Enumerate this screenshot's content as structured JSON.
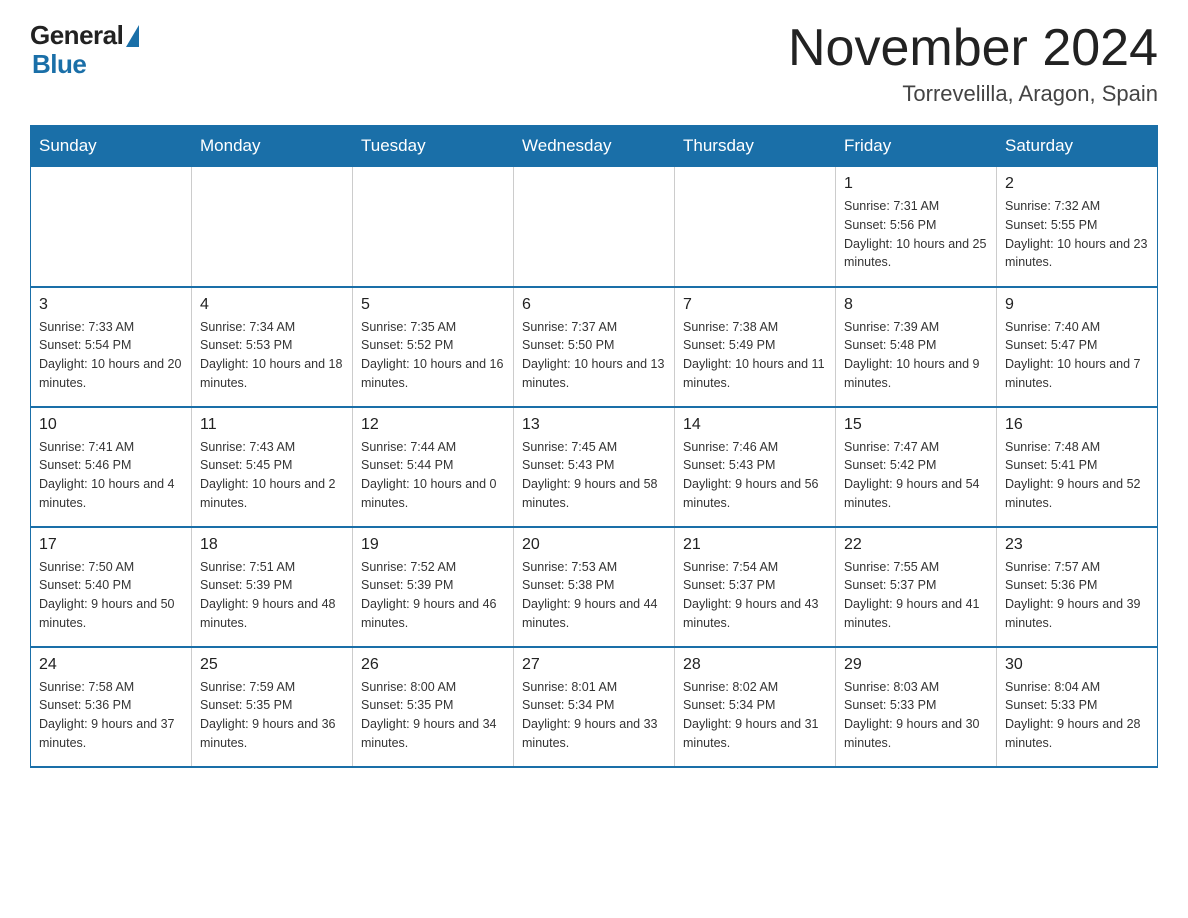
{
  "header": {
    "logo_general": "General",
    "logo_blue": "Blue",
    "month_title": "November 2024",
    "location": "Torrevelilla, Aragon, Spain"
  },
  "days_of_week": [
    "Sunday",
    "Monday",
    "Tuesday",
    "Wednesday",
    "Thursday",
    "Friday",
    "Saturday"
  ],
  "weeks": [
    [
      {
        "day": "",
        "info": ""
      },
      {
        "day": "",
        "info": ""
      },
      {
        "day": "",
        "info": ""
      },
      {
        "day": "",
        "info": ""
      },
      {
        "day": "",
        "info": ""
      },
      {
        "day": "1",
        "info": "Sunrise: 7:31 AM\nSunset: 5:56 PM\nDaylight: 10 hours and 25 minutes."
      },
      {
        "day": "2",
        "info": "Sunrise: 7:32 AM\nSunset: 5:55 PM\nDaylight: 10 hours and 23 minutes."
      }
    ],
    [
      {
        "day": "3",
        "info": "Sunrise: 7:33 AM\nSunset: 5:54 PM\nDaylight: 10 hours and 20 minutes."
      },
      {
        "day": "4",
        "info": "Sunrise: 7:34 AM\nSunset: 5:53 PM\nDaylight: 10 hours and 18 minutes."
      },
      {
        "day": "5",
        "info": "Sunrise: 7:35 AM\nSunset: 5:52 PM\nDaylight: 10 hours and 16 minutes."
      },
      {
        "day": "6",
        "info": "Sunrise: 7:37 AM\nSunset: 5:50 PM\nDaylight: 10 hours and 13 minutes."
      },
      {
        "day": "7",
        "info": "Sunrise: 7:38 AM\nSunset: 5:49 PM\nDaylight: 10 hours and 11 minutes."
      },
      {
        "day": "8",
        "info": "Sunrise: 7:39 AM\nSunset: 5:48 PM\nDaylight: 10 hours and 9 minutes."
      },
      {
        "day": "9",
        "info": "Sunrise: 7:40 AM\nSunset: 5:47 PM\nDaylight: 10 hours and 7 minutes."
      }
    ],
    [
      {
        "day": "10",
        "info": "Sunrise: 7:41 AM\nSunset: 5:46 PM\nDaylight: 10 hours and 4 minutes."
      },
      {
        "day": "11",
        "info": "Sunrise: 7:43 AM\nSunset: 5:45 PM\nDaylight: 10 hours and 2 minutes."
      },
      {
        "day": "12",
        "info": "Sunrise: 7:44 AM\nSunset: 5:44 PM\nDaylight: 10 hours and 0 minutes."
      },
      {
        "day": "13",
        "info": "Sunrise: 7:45 AM\nSunset: 5:43 PM\nDaylight: 9 hours and 58 minutes."
      },
      {
        "day": "14",
        "info": "Sunrise: 7:46 AM\nSunset: 5:43 PM\nDaylight: 9 hours and 56 minutes."
      },
      {
        "day": "15",
        "info": "Sunrise: 7:47 AM\nSunset: 5:42 PM\nDaylight: 9 hours and 54 minutes."
      },
      {
        "day": "16",
        "info": "Sunrise: 7:48 AM\nSunset: 5:41 PM\nDaylight: 9 hours and 52 minutes."
      }
    ],
    [
      {
        "day": "17",
        "info": "Sunrise: 7:50 AM\nSunset: 5:40 PM\nDaylight: 9 hours and 50 minutes."
      },
      {
        "day": "18",
        "info": "Sunrise: 7:51 AM\nSunset: 5:39 PM\nDaylight: 9 hours and 48 minutes."
      },
      {
        "day": "19",
        "info": "Sunrise: 7:52 AM\nSunset: 5:39 PM\nDaylight: 9 hours and 46 minutes."
      },
      {
        "day": "20",
        "info": "Sunrise: 7:53 AM\nSunset: 5:38 PM\nDaylight: 9 hours and 44 minutes."
      },
      {
        "day": "21",
        "info": "Sunrise: 7:54 AM\nSunset: 5:37 PM\nDaylight: 9 hours and 43 minutes."
      },
      {
        "day": "22",
        "info": "Sunrise: 7:55 AM\nSunset: 5:37 PM\nDaylight: 9 hours and 41 minutes."
      },
      {
        "day": "23",
        "info": "Sunrise: 7:57 AM\nSunset: 5:36 PM\nDaylight: 9 hours and 39 minutes."
      }
    ],
    [
      {
        "day": "24",
        "info": "Sunrise: 7:58 AM\nSunset: 5:36 PM\nDaylight: 9 hours and 37 minutes."
      },
      {
        "day": "25",
        "info": "Sunrise: 7:59 AM\nSunset: 5:35 PM\nDaylight: 9 hours and 36 minutes."
      },
      {
        "day": "26",
        "info": "Sunrise: 8:00 AM\nSunset: 5:35 PM\nDaylight: 9 hours and 34 minutes."
      },
      {
        "day": "27",
        "info": "Sunrise: 8:01 AM\nSunset: 5:34 PM\nDaylight: 9 hours and 33 minutes."
      },
      {
        "day": "28",
        "info": "Sunrise: 8:02 AM\nSunset: 5:34 PM\nDaylight: 9 hours and 31 minutes."
      },
      {
        "day": "29",
        "info": "Sunrise: 8:03 AM\nSunset: 5:33 PM\nDaylight: 9 hours and 30 minutes."
      },
      {
        "day": "30",
        "info": "Sunrise: 8:04 AM\nSunset: 5:33 PM\nDaylight: 9 hours and 28 minutes."
      }
    ]
  ]
}
